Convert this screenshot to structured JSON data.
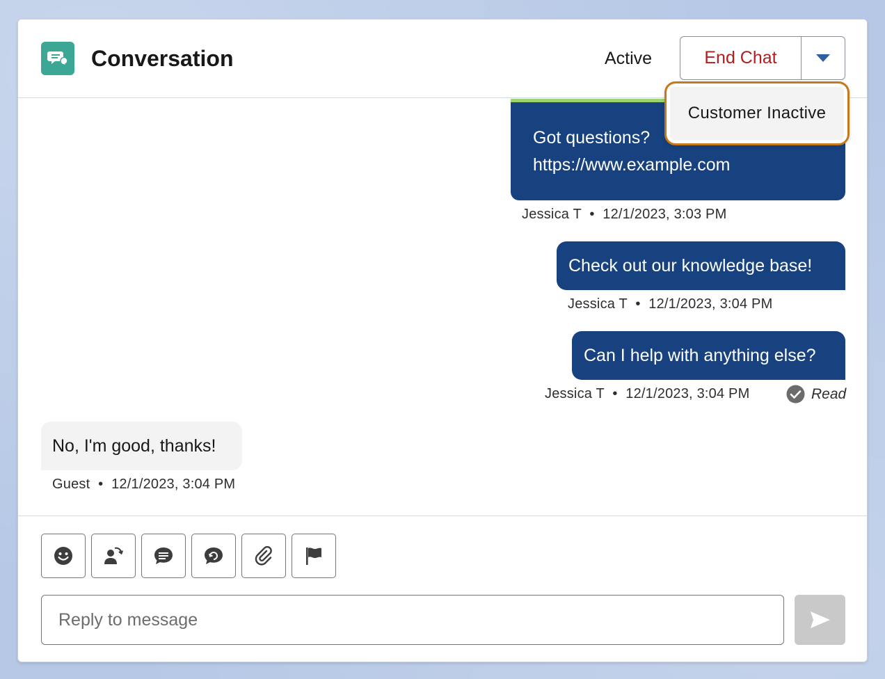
{
  "header": {
    "title": "Conversation",
    "status": "Active",
    "end_chat_label": "End Chat"
  },
  "menu": {
    "items": [
      {
        "label": "Customer Inactive"
      }
    ]
  },
  "messages": [
    {
      "text_lines": [
        "Got questions?",
        "https://www.example.com"
      ],
      "sender": "Jessica T",
      "time": "12/1/2023, 3:03 PM"
    },
    {
      "text": "Check out our knowledge base!",
      "sender": "Jessica T",
      "time": "12/1/2023, 3:04 PM"
    },
    {
      "text": "Can I help with anything else?",
      "sender": "Jessica T",
      "time": "12/1/2023, 3:04 PM",
      "receipt": "Read"
    },
    {
      "text": "No, I'm good, thanks!",
      "sender": "Guest",
      "time": "12/1/2023, 3:04 PM"
    }
  ],
  "separator": "•",
  "composer": {
    "placeholder": "Reply to message",
    "tools": [
      "emoji-icon",
      "transfer-icon",
      "quick-text-icon",
      "knowledge-icon",
      "attach-icon",
      "flag-icon"
    ]
  },
  "colors": {
    "brand_icon": "#3ba794",
    "outgoing_bubble": "#17427f",
    "end_chat_text": "#b21d1d",
    "menu_highlight": "#c6791c"
  }
}
